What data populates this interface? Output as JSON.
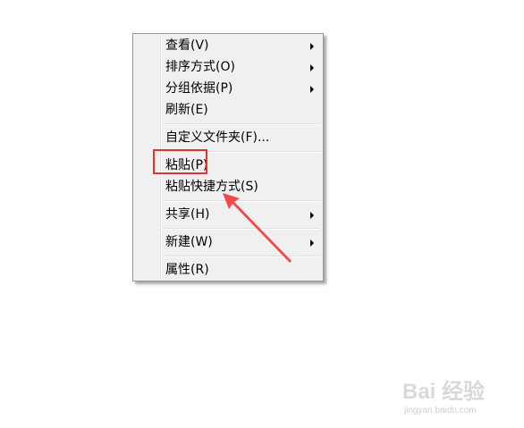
{
  "context_menu": {
    "items": [
      {
        "label": "查看(V)",
        "has_submenu": true
      },
      {
        "label": "排序方式(O)",
        "has_submenu": true
      },
      {
        "label": "分组依据(P)",
        "has_submenu": true
      },
      {
        "label": "刷新(E)",
        "has_submenu": false
      },
      {
        "label": "自定义文件夹(F)...",
        "has_submenu": false
      },
      {
        "label": "粘贴(P)",
        "has_submenu": false,
        "highlighted": true
      },
      {
        "label": "粘贴快捷方式(S)",
        "has_submenu": false
      },
      {
        "label": "共享(H)",
        "has_submenu": true
      },
      {
        "label": "新建(W)",
        "has_submenu": true
      },
      {
        "label": "属性(R)",
        "has_submenu": false
      }
    ]
  },
  "annotation": {
    "highlight_color": "#e23232",
    "arrow_color": "#f04a4a"
  },
  "watermark": {
    "main": "Bai 经验",
    "sub": "jingyan.baidu.com"
  }
}
